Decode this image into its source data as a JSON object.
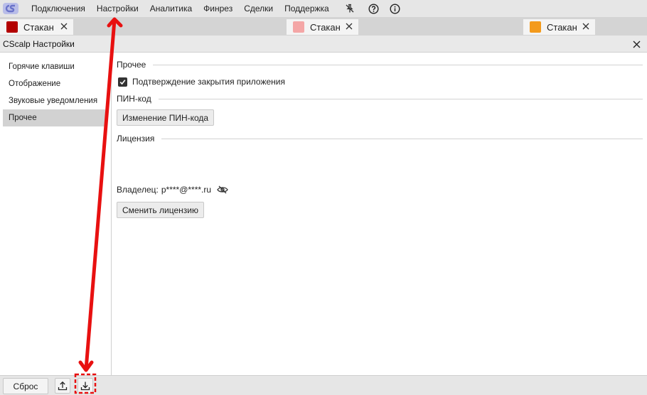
{
  "menu": {
    "items": [
      "Подключения",
      "Настройки",
      "Аналитика",
      "Финрез",
      "Сделки",
      "Поддержка"
    ],
    "icons": [
      "pin-off-icon",
      "help-icon",
      "info-icon"
    ]
  },
  "tabs": [
    {
      "label": "Стакан",
      "color": "#b30000"
    },
    {
      "label": "Стакан",
      "color": "#f4a6a6"
    },
    {
      "label": "Стакан",
      "color": "#f39a1c"
    }
  ],
  "window": {
    "title": "CScalp Настройки"
  },
  "sidebar": {
    "items": [
      {
        "label": "Горячие клавиши"
      },
      {
        "label": "Отображение"
      },
      {
        "label": "Звуковые уведомления"
      },
      {
        "label": "Прочее",
        "active": true
      }
    ]
  },
  "content": {
    "misc": {
      "header": "Прочее",
      "confirm_close_label": "Подтверждение закрытия приложения",
      "confirm_close_checked": true
    },
    "pin": {
      "header": "ПИН-код",
      "change_button": "Изменение ПИН-кода"
    },
    "license": {
      "header": "Лицензия",
      "owner_label": "Владелец:",
      "owner_value": "p****@****.ru",
      "change_button": "Сменить лицензию"
    }
  },
  "bottom": {
    "reset_label": "Сброс"
  },
  "colors": {
    "annotation": "#e81010"
  }
}
